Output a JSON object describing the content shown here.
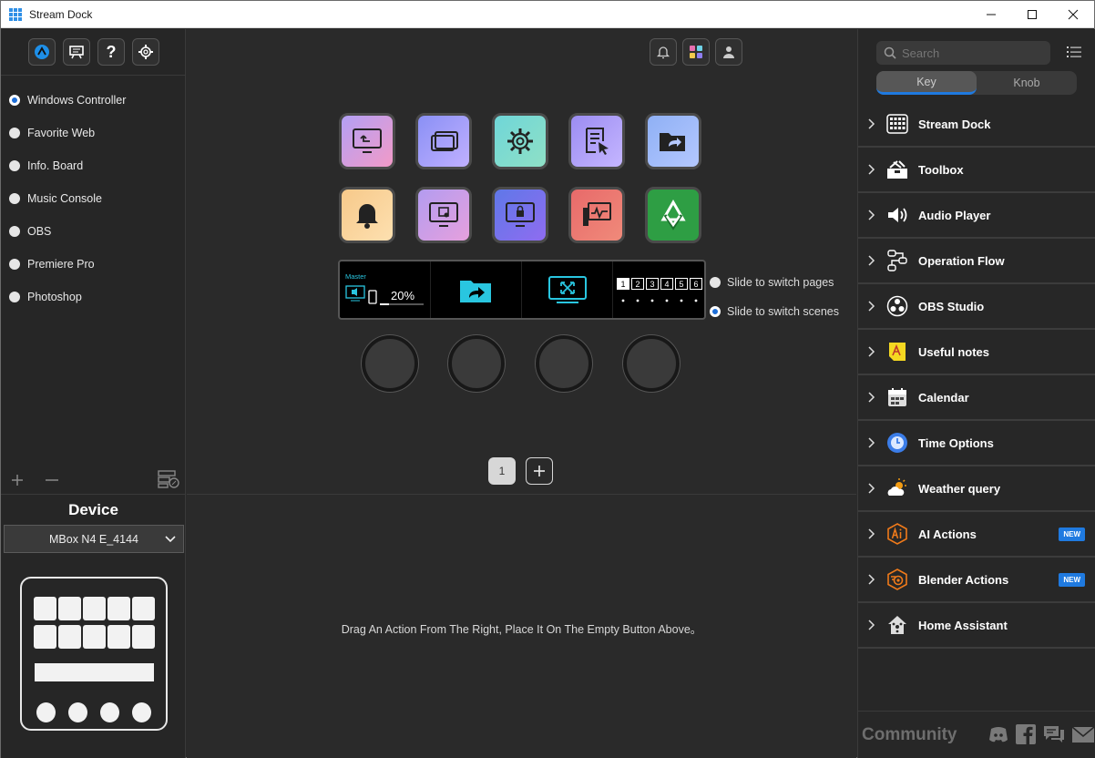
{
  "window": {
    "title": "Stream Dock"
  },
  "profiles": [
    {
      "label": "Windows Controller",
      "selected": true
    },
    {
      "label": "Favorite Web",
      "selected": false
    },
    {
      "label": "Info. Board",
      "selected": false
    },
    {
      "label": "Music Console",
      "selected": false
    },
    {
      "label": "OBS",
      "selected": false
    },
    {
      "label": "Premiere Pro",
      "selected": false
    },
    {
      "label": "Photoshop",
      "selected": false
    }
  ],
  "device": {
    "title": "Device",
    "selected": "MBox N4 E_4144"
  },
  "strip": {
    "master_label": "Master",
    "volume": "20%",
    "volume_level": 0.2,
    "pages": [
      "1",
      "2",
      "3",
      "4",
      "5",
      "6"
    ],
    "active_page": "1"
  },
  "slide_options": [
    {
      "label": "Slide to switch pages",
      "selected": false
    },
    {
      "label": "Slide to switch scenes",
      "selected": true
    }
  ],
  "page_button": "1",
  "hint": "Drag An Action From The Right, Place It On The Empty Button Above。",
  "search": {
    "placeholder": "Search"
  },
  "tabs": {
    "key": "Key",
    "knob": "Knob",
    "active": "Key"
  },
  "categories": [
    {
      "label": "Stream Dock",
      "icon": "grid-icon"
    },
    {
      "label": "Toolbox",
      "icon": "toolbox-icon"
    },
    {
      "label": "Audio Player",
      "icon": "speaker-icon"
    },
    {
      "label": "Operation Flow",
      "icon": "flow-icon"
    },
    {
      "label": "OBS Studio",
      "icon": "obs-icon"
    },
    {
      "label": "Useful notes",
      "icon": "notes-icon"
    },
    {
      "label": "Calendar",
      "icon": "calendar-icon"
    },
    {
      "label": "Time Options",
      "icon": "clock-icon"
    },
    {
      "label": "Weather query",
      "icon": "weather-icon"
    },
    {
      "label": "AI Actions",
      "icon": "ai-icon",
      "badge": "NEW"
    },
    {
      "label": "Blender Actions",
      "icon": "blender-icon",
      "badge": "NEW"
    },
    {
      "label": "Home Assistant",
      "icon": "home-icon"
    }
  ],
  "community": "Community",
  "colors": {
    "accent": "#1f7ae0",
    "background": "#2a2a2a"
  }
}
